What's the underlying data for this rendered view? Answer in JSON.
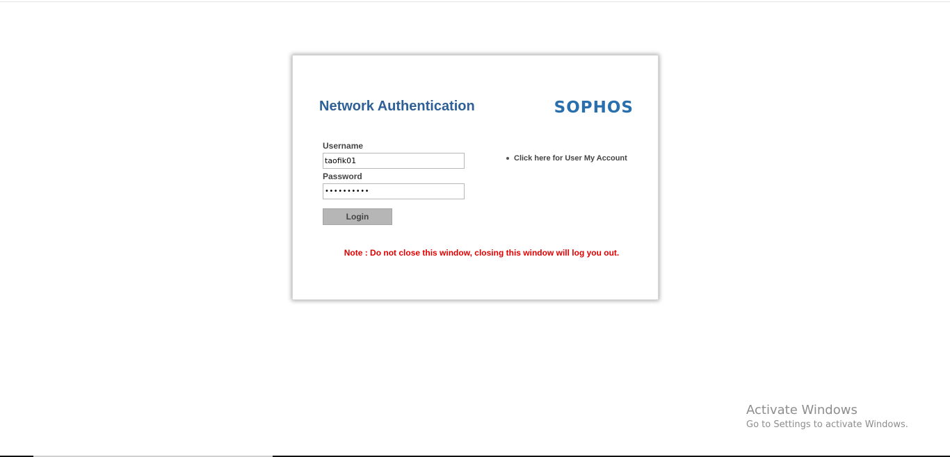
{
  "login": {
    "title": "Network Authentication",
    "logo_text": "SOPHOS",
    "username_label": "Username",
    "username_value": "taofik01",
    "password_label": "Password",
    "password_value": "••••••••••",
    "login_button": "Login",
    "account_link": "Click here for User My Account",
    "note": "Note : Do not close this window, closing this window will log you out."
  },
  "watermark": {
    "title": "Activate Windows",
    "subtitle": "Go to Settings to activate Windows."
  },
  "colors": {
    "title": "#2e6097",
    "logo": "#2a6fad",
    "note": "#e00000",
    "button": "#b6b6b6"
  }
}
